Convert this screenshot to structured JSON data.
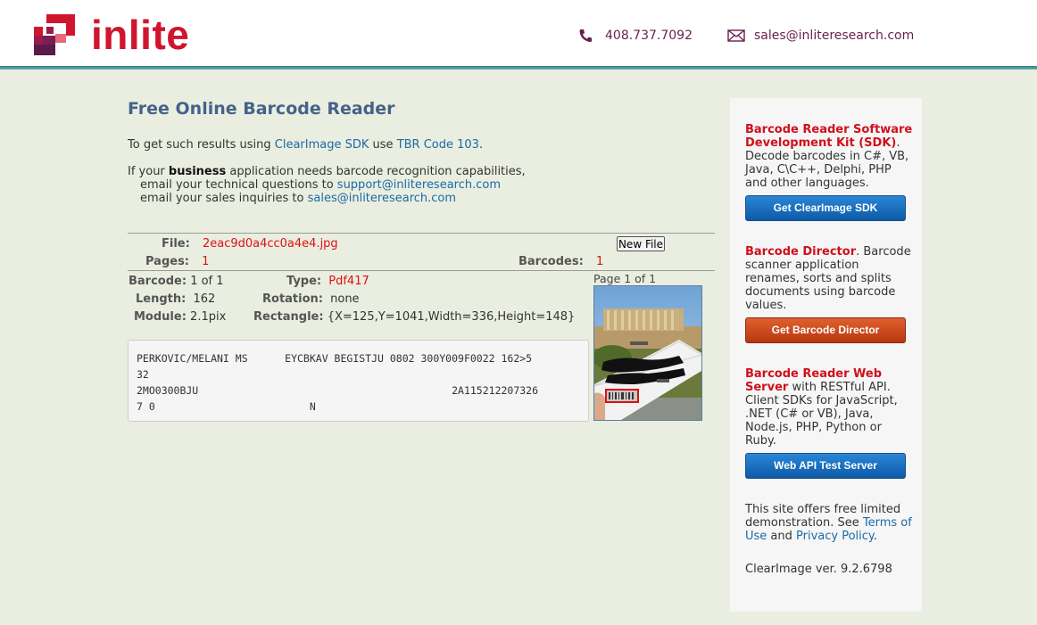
{
  "header": {
    "logo_text": "inlite",
    "phone": "408.737.7092",
    "email": "sales@inliteresearch.com",
    "icons": [
      "phone-icon",
      "envelope-icon"
    ]
  },
  "main": {
    "title": "Free Online Barcode Reader",
    "intro": {
      "prefix": "To get such results using ",
      "sdk_link": "ClearImage SDK",
      "middle": " use ",
      "code_link": "TBR Code 103",
      "suffix": "."
    },
    "business": {
      "prefix": "If your ",
      "bold": "business",
      "suffix": " application needs barcode recognition capabilities,",
      "line2_prefix": "email your technical questions to ",
      "support_email": "support@inliteresearch.com",
      "line3_prefix": "email your sales inquiries to ",
      "sales_email": "sales@inliteresearch.com"
    }
  },
  "result": {
    "file_label": "File:",
    "file_value": "2eac9d0a4cc0a4e4.jpg",
    "new_file_button": "New File",
    "pages_label": "Pages:",
    "pages_value": "1",
    "barcodes_label": "Barcodes:",
    "barcodes_value": "1",
    "barcode_label": "Barcode:",
    "barcode_value": "1 of 1",
    "type_label": "Type:",
    "type_value": "Pdf417",
    "length_label": "Length:",
    "length_value": "162",
    "rotation_label": "Rotation:",
    "rotation_value": "none",
    "module_label": "Module:",
    "module_value": "2.1pix",
    "rectangle_label": "Rectangle:",
    "rectangle_value": "{X=125,Y=1041,Width=336,Height=148}",
    "decoded_text": "PERKOVIC/MELANI MS      EYCBKAV BEGISTJU 0802 300Y009F0022 162>5\n32\n2MO0300BJU                                         2A115212207326\n7 0                         N",
    "page_of": "Page 1 of 1"
  },
  "sidebar": {
    "sdk": {
      "title": "Barcode Reader Software Development Kit (SDK)",
      "desc": "Decode barcodes in C#, VB, Java, C\\C++, Delphi, PHP and other languages.",
      "button": "Get ClearImage SDK"
    },
    "director": {
      "title": "Barcode Director",
      "desc": "Barcode scanner application renames, sorts and splits documents using barcode values.",
      "button": "Get Barcode Director"
    },
    "webserver": {
      "title": "Barcode Reader Web Server",
      "desc": "with RESTful API. Client SDKs for JavaScript, .NET (C# or VB), Java, Node.js, PHP, Python or Ruby.",
      "button": "Web API Test Server"
    },
    "notice": {
      "prefix": "This site offers free limited demonstration. See ",
      "terms_link": "Terms of Use",
      "and": " and ",
      "privacy_link": "Privacy Policy",
      "suffix": "."
    },
    "version": "ClearImage ver. 9.2.6798"
  },
  "colors": {
    "accent_red": "#d0152e",
    "link_blue": "#1a6aa8",
    "header_teal": "#2f7f86",
    "page_bg": "#eaeee0"
  }
}
